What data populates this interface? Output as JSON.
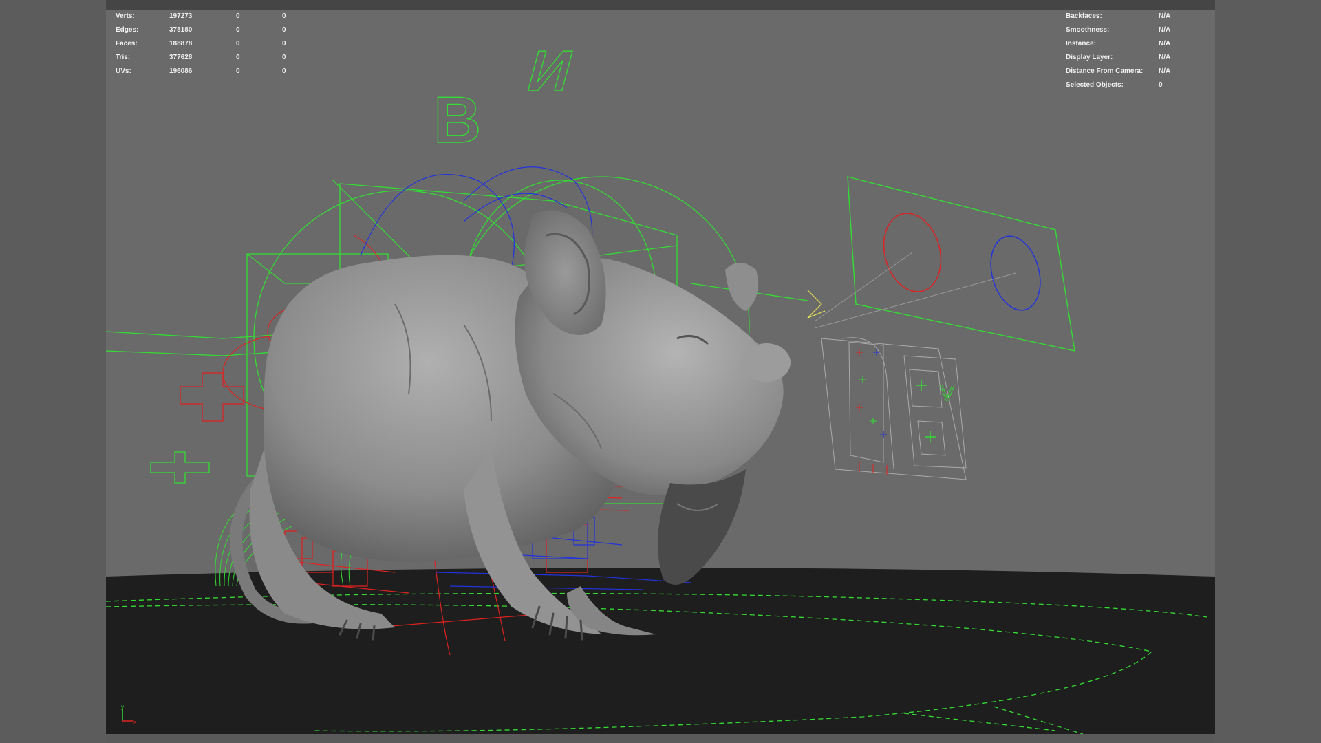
{
  "hud_left": {
    "rows": [
      {
        "label": "Verts:",
        "total": "197273",
        "selected": "0",
        "triangles": "0"
      },
      {
        "label": "Edges:",
        "total": "378180",
        "selected": "0",
        "triangles": "0"
      },
      {
        "label": "Faces:",
        "total": "188878",
        "selected": "0",
        "triangles": "0"
      },
      {
        "label": "Tris:",
        "total": "377628",
        "selected": "0",
        "triangles": "0"
      },
      {
        "label": "UVs:",
        "total": "196086",
        "selected": "0",
        "triangles": "0"
      }
    ]
  },
  "hud_right": {
    "rows": [
      {
        "label": "Backfaces:",
        "value": "N/A"
      },
      {
        "label": "Smoothness:",
        "value": "N/A"
      },
      {
        "label": "Instance:",
        "value": "N/A"
      },
      {
        "label": "Display Layer:",
        "value": "N/A"
      },
      {
        "label": "Distance From Camera:",
        "value": "N/A"
      },
      {
        "label": "Selected Objects:",
        "value": "0"
      }
    ]
  },
  "axis_labels": {
    "y": "y",
    "x": "x"
  },
  "controls_text": {
    "letter_b": "B",
    "letter_n": "И",
    "letter_v": "V"
  },
  "colors": {
    "viewport_bg": "#6a6a6a",
    "ground": "#1e1e1e",
    "control_green": "#33dd33",
    "control_red": "#dd2222",
    "control_blue": "#2233dd",
    "mesh_gray": "#8a8a8a"
  }
}
